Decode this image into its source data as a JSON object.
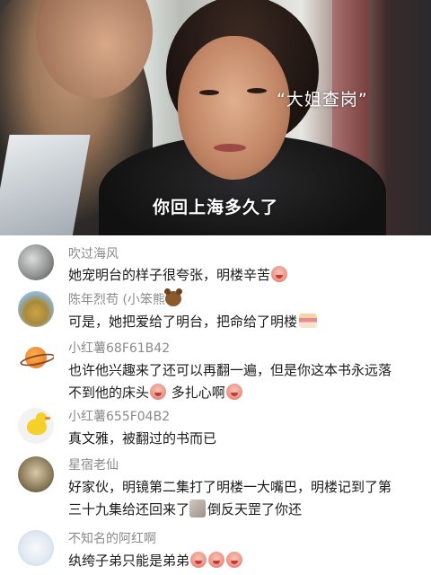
{
  "video": {
    "watermark": "“大姐查岗”",
    "subtitle": "你回上海多久了"
  },
  "comments": [
    {
      "user": "吹过海风",
      "text": "她宠明台的样子很夸张，明楼辛苦",
      "emojis_after": [
        "crying-face"
      ]
    },
    {
      "user": "陈年烈苟 (小笨熊",
      "user_emoji": "bear-face",
      "text": "可是，她把爱给了明台，把命给了明楼",
      "emojis_after": [
        "cake"
      ]
    },
    {
      "user": "小红薯68F61B42",
      "line1": "也许他兴趣来了还可以再翻一遍，但是你这本书永远落",
      "line2": "不到他的床头",
      "line2_mid": " 多扎心啊"
    },
    {
      "user": "小红薯655F04B2",
      "text": "真文雅，被翻过的书而已"
    },
    {
      "user": "星宿老仙",
      "line1": "好家伙，明镜第二集打了明楼一大嘴巴，明楼记到了第",
      "line2": "三十九集给还回来了",
      "line2_end": "倒反天罡了你还"
    },
    {
      "user": "不知名的阿红啊",
      "text": "纨绔子弟只能是弟弟"
    }
  ]
}
